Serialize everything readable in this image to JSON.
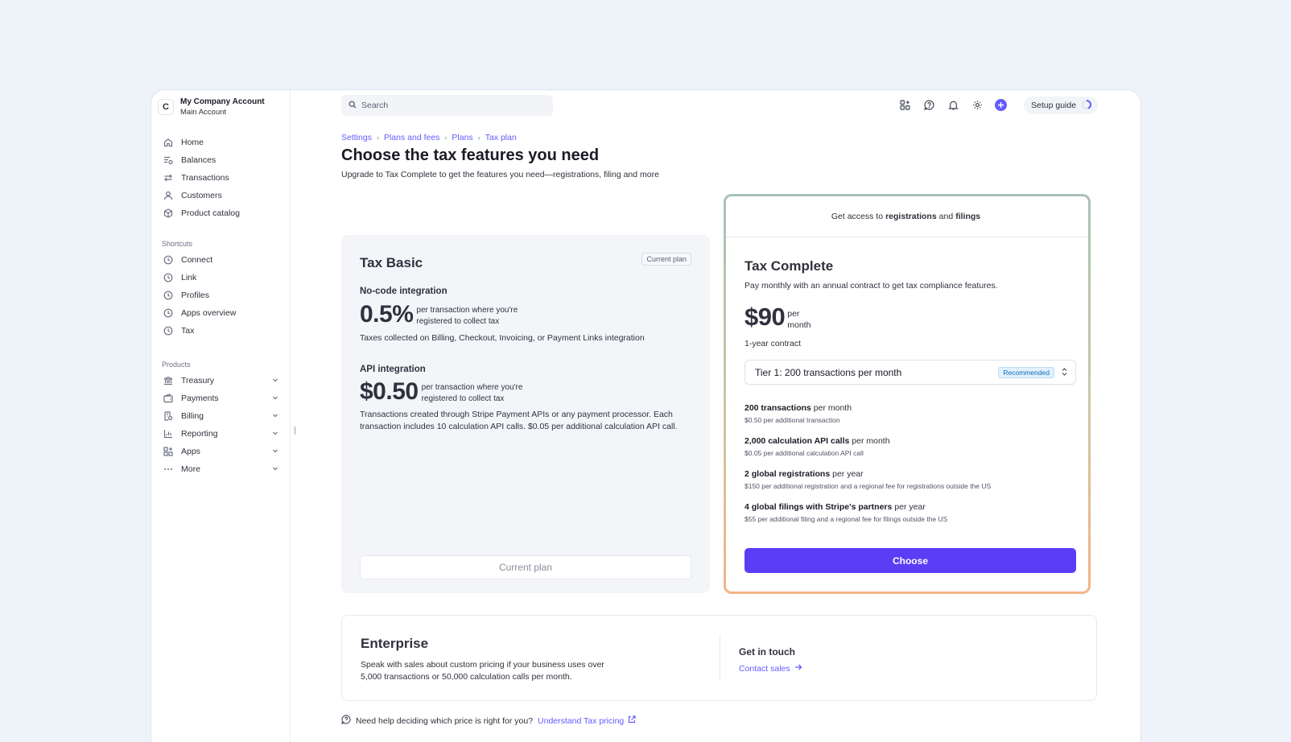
{
  "account": {
    "initial": "C",
    "name": "My Company Account",
    "sub": "Main Account"
  },
  "nav": {
    "main": [
      {
        "label": "Home",
        "icon": "home-icon"
      },
      {
        "label": "Balances",
        "icon": "balances-icon"
      },
      {
        "label": "Transactions",
        "icon": "transactions-icon"
      },
      {
        "label": "Customers",
        "icon": "user-icon"
      },
      {
        "label": "Product catalog",
        "icon": "box-icon"
      }
    ],
    "shortcuts_label": "Shortcuts",
    "shortcuts": [
      {
        "label": "Connect",
        "icon": "clock-icon"
      },
      {
        "label": "Link",
        "icon": "clock-icon"
      },
      {
        "label": "Profiles",
        "icon": "clock-icon"
      },
      {
        "label": "Apps overview",
        "icon": "clock-icon"
      },
      {
        "label": "Tax",
        "icon": "clock-icon"
      }
    ],
    "products_label": "Products",
    "products": [
      {
        "label": "Treasury",
        "icon": "bank-icon"
      },
      {
        "label": "Payments",
        "icon": "wallet-icon"
      },
      {
        "label": "Billing",
        "icon": "receipt-icon"
      },
      {
        "label": "Reporting",
        "icon": "bar-chart-icon"
      },
      {
        "label": "Apps",
        "icon": "apps-icon"
      },
      {
        "label": "More",
        "icon": "ellipsis-icon"
      }
    ]
  },
  "topbar": {
    "search_placeholder": "Search",
    "setup_label": "Setup guide"
  },
  "breadcrumb": [
    "Settings",
    "Plans and fees",
    "Plans",
    "Tax plan"
  ],
  "header": {
    "title": "Choose the tax features you need",
    "subtitle": "Upgrade to Tax Complete to get the features you need—registrations, filing and more"
  },
  "basic": {
    "title": "Tax Basic",
    "badge": "Current plan",
    "nocode": {
      "heading": "No-code integration",
      "price": "0.5%",
      "note": "per transaction where you're registered to collect tax",
      "desc": "Taxes collected on Billing, Checkout, Invoicing, or Payment Links integration"
    },
    "api": {
      "heading": "API integration",
      "price": "$0.50",
      "note": "per transaction where you're registered to collect tax",
      "desc": "Transactions created through Stripe Payment APIs or any payment processor. Each transaction includes 10 calculation API calls. $0.05 per additional calculation API call."
    },
    "button": "Current plan"
  },
  "complete": {
    "banner_pre": "Get access to",
    "banner_b1": "registrations",
    "banner_mid": "and",
    "banner_b2": "filings",
    "title": "Tax Complete",
    "desc": "Pay monthly with an annual contract to get tax compliance features.",
    "price": "$90",
    "unit_1": "per",
    "unit_2": "month",
    "contract": "1-year contract",
    "tier": "Tier 1: 200 transactions per month",
    "tier_badge": "Recommended",
    "includes": [
      {
        "bold": "200 transactions",
        "rest": " per month",
        "sub": "$0.50 per additional transaction"
      },
      {
        "bold": "2,000 calculation API calls",
        "rest": " per month",
        "sub": "$0.05 per additional calculation API call"
      },
      {
        "bold": "2 global registrations",
        "rest": " per year",
        "sub": "$150 per additional registration and a regional fee for registrations outside the US"
      },
      {
        "bold": "4 global filings with Stripe's partners",
        "rest": " per year",
        "sub": "$55 per additional filing and a regional fee for filings outside the US"
      }
    ],
    "button": "Choose"
  },
  "enterprise": {
    "title": "Enterprise",
    "desc": "Speak with sales about custom pricing if your business uses over 5,000 transactions or 50,000 calculation calls per month.",
    "get_in_touch": "Get in touch",
    "contact": "Contact sales"
  },
  "help": {
    "text": "Need help deciding which price is right for you?",
    "link": "Understand Tax pricing"
  },
  "colors": {
    "accent": "#635bff",
    "button": "#5b3df6",
    "background": "#eef2f9"
  }
}
